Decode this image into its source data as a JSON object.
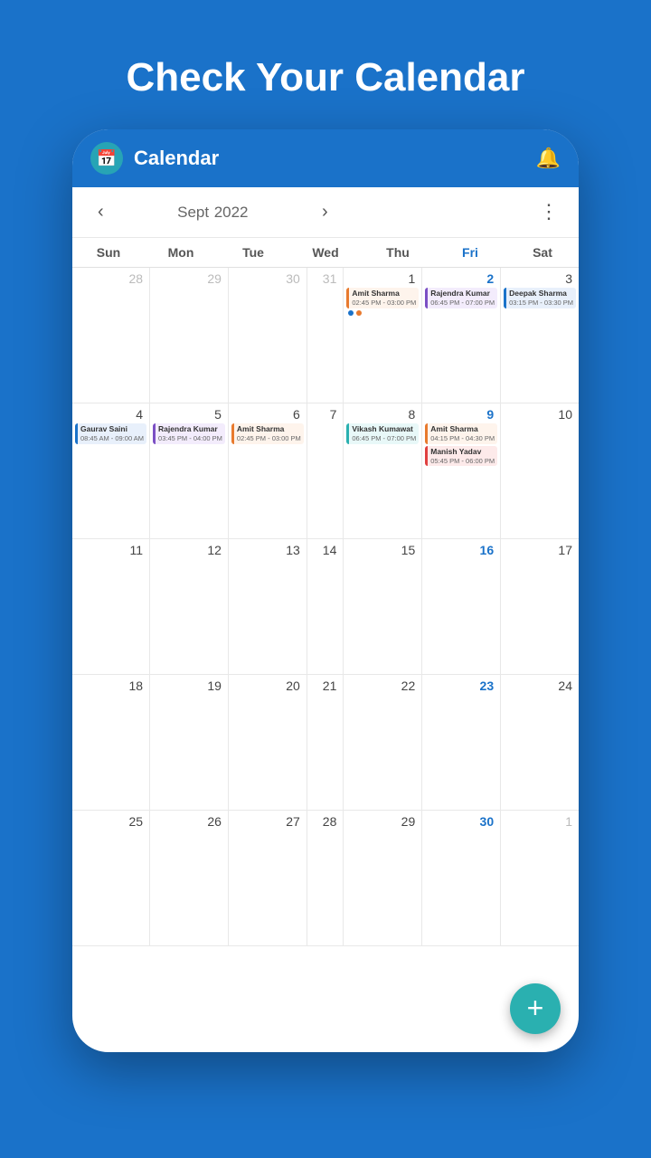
{
  "hero": {
    "title": "Check Your Calendar"
  },
  "app": {
    "title": "Calendar",
    "logo_text": "📅"
  },
  "nav": {
    "month": "Sept",
    "year": "2022",
    "prev_label": "‹",
    "next_label": "›",
    "more_label": "⋮"
  },
  "day_headers": [
    "Sun",
    "Mon",
    "Tue",
    "Wed",
    "Thu",
    "Fri",
    "Sat"
  ],
  "weeks": [
    [
      {
        "num": "28",
        "other": true,
        "events": []
      },
      {
        "num": "29",
        "other": true,
        "events": []
      },
      {
        "num": "30",
        "other": true,
        "events": []
      },
      {
        "num": "31",
        "other": true,
        "events": []
      },
      {
        "num": "1",
        "events": [
          {
            "name": "Amit Sharma",
            "time": "02:45 PM - 03:00 PM",
            "color": "orange"
          }
        ],
        "dots": [
          "blue",
          "orange"
        ]
      },
      {
        "num": "2",
        "fri": true,
        "events": [
          {
            "name": "Rajendra Kumar",
            "time": "06:45 PM - 07:00 PM",
            "color": "purple"
          }
        ]
      },
      {
        "num": "3",
        "events": [
          {
            "name": "Deepak Sharma",
            "time": "03:15 PM - 03:30 PM",
            "color": "blue"
          }
        ]
      }
    ],
    [
      {
        "num": "4",
        "events": [
          {
            "name": "Gaurav Saini",
            "time": "08:45 AM - 09:00 AM",
            "color": "blue"
          }
        ]
      },
      {
        "num": "5",
        "events": [
          {
            "name": "Rajendra Kumar",
            "time": "03:45 PM - 04:00 PM",
            "color": "purple"
          }
        ]
      },
      {
        "num": "6",
        "events": [
          {
            "name": "Amit Sharma",
            "time": "02:45 PM - 03:00 PM",
            "color": "orange"
          }
        ]
      },
      {
        "num": "7",
        "events": []
      },
      {
        "num": "8",
        "events": [
          {
            "name": "Vikash Kumawat",
            "time": "06:45 PM - 07:00 PM",
            "color": "teal"
          }
        ]
      },
      {
        "num": "9",
        "fri": true,
        "events": [
          {
            "name": "Amit Sharma",
            "time": "04:15 PM - 04:30 PM",
            "color": "orange"
          },
          {
            "name": "Manish Yadav",
            "time": "05:45 PM - 06:00 PM",
            "color": "red"
          }
        ]
      },
      {
        "num": "10",
        "events": []
      }
    ],
    [
      {
        "num": "11",
        "events": []
      },
      {
        "num": "12",
        "events": []
      },
      {
        "num": "13",
        "events": []
      },
      {
        "num": "14",
        "events": []
      },
      {
        "num": "15",
        "events": []
      },
      {
        "num": "16",
        "fri": true,
        "events": []
      },
      {
        "num": "17",
        "events": []
      }
    ],
    [
      {
        "num": "18",
        "events": []
      },
      {
        "num": "19",
        "events": []
      },
      {
        "num": "20",
        "events": []
      },
      {
        "num": "21",
        "events": []
      },
      {
        "num": "22",
        "events": []
      },
      {
        "num": "23",
        "fri": true,
        "events": []
      },
      {
        "num": "24",
        "events": []
      }
    ],
    [
      {
        "num": "25",
        "events": []
      },
      {
        "num": "26",
        "events": []
      },
      {
        "num": "27",
        "events": []
      },
      {
        "num": "28",
        "events": []
      },
      {
        "num": "29",
        "events": []
      },
      {
        "num": "30",
        "fri": true,
        "events": []
      },
      {
        "num": "1",
        "other": true,
        "events": []
      }
    ]
  ],
  "fab": {
    "label": "+"
  }
}
